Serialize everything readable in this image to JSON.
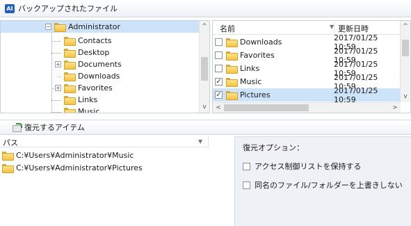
{
  "header": {
    "badge": "AI",
    "title": "バックアップされたファイル"
  },
  "tree": {
    "items": [
      {
        "label": "Administrator",
        "expander": "−"
      },
      {
        "label": "Contacts"
      },
      {
        "label": "Desktop"
      },
      {
        "label": "Documents",
        "expander": "+"
      },
      {
        "label": "Downloads"
      },
      {
        "label": "Favorites",
        "expander": "+"
      },
      {
        "label": "Links"
      },
      {
        "label": "Music"
      }
    ],
    "scroll_up": "^",
    "scroll_down": "v"
  },
  "file_list": {
    "col_name": "名前",
    "col_date": "更新日時",
    "rows": [
      {
        "name": "Downloads",
        "date": "2017/01/25 10:59",
        "checked": ""
      },
      {
        "name": "Favorites",
        "date": "2017/01/25 10:59",
        "checked": ""
      },
      {
        "name": "Links",
        "date": "2017/01/25 10:59",
        "checked": ""
      },
      {
        "name": "Music",
        "date": "2017/01/25 10:59",
        "checked": "✓"
      },
      {
        "name": "Pictures",
        "date": "2017/01/25 10:59",
        "checked": "✓"
      }
    ],
    "scroll_up": "^",
    "scroll_down": "v",
    "scroll_left": "<",
    "scroll_right": ">"
  },
  "restore": {
    "title": "復元するアイテム",
    "path_header": "パス",
    "paths": [
      "C:¥Users¥Administrator¥Music",
      "C:¥Users¥Administrator¥Pictures"
    ]
  },
  "options": {
    "title": "復元オプション：",
    "items": [
      {
        "label": "アクセス制御リストを保持する"
      },
      {
        "label": "同名のファイル/フォルダーを上書きしない"
      }
    ]
  },
  "colors": {
    "selection": "#cde3fa",
    "badge": "#1f5fbf",
    "folder": "#f5c242"
  }
}
